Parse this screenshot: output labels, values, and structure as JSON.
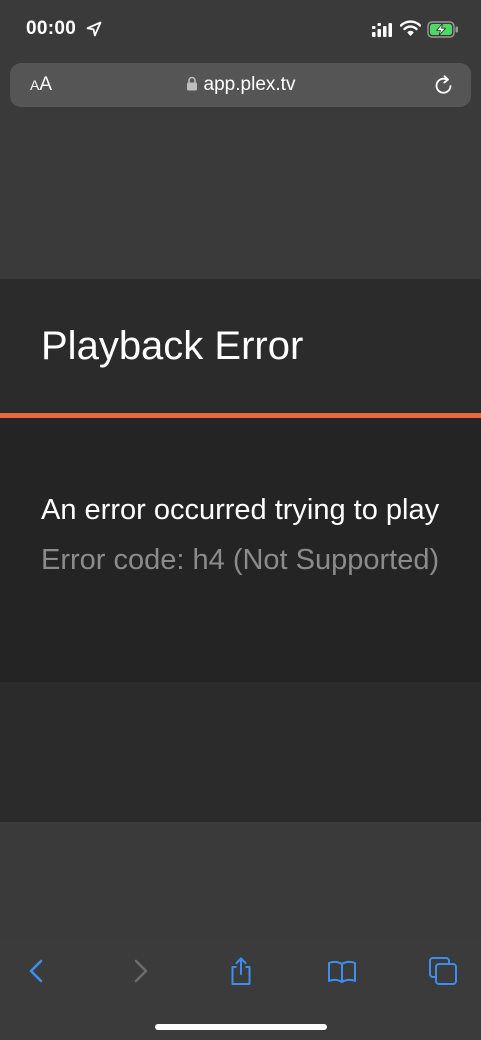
{
  "status_bar": {
    "time": "00:00",
    "icons": [
      "location-arrow-icon",
      "cellular-signal-icon",
      "wifi-icon",
      "battery-charging-icon"
    ]
  },
  "browser": {
    "text_size_label_small": "A",
    "text_size_label_large": "A",
    "url": "app.plex.tv",
    "lock_icon": "lock-icon",
    "reload_icon": "reload-icon"
  },
  "dialog": {
    "title": "Playback Error",
    "message": "An error occurred trying to play",
    "error_code": "Error code: h4 (Not Supported)",
    "accent_color": "#e5683e"
  },
  "toolbar": {
    "buttons": [
      {
        "name": "back",
        "icon": "chevron-left-icon",
        "enabled": true
      },
      {
        "name": "forward",
        "icon": "chevron-right-icon",
        "enabled": false
      },
      {
        "name": "share",
        "icon": "share-icon",
        "enabled": true
      },
      {
        "name": "bookmarks",
        "icon": "book-icon",
        "enabled": true
      },
      {
        "name": "tabs",
        "icon": "tabs-icon",
        "enabled": true
      }
    ],
    "accent_color": "#3d8ef0"
  }
}
